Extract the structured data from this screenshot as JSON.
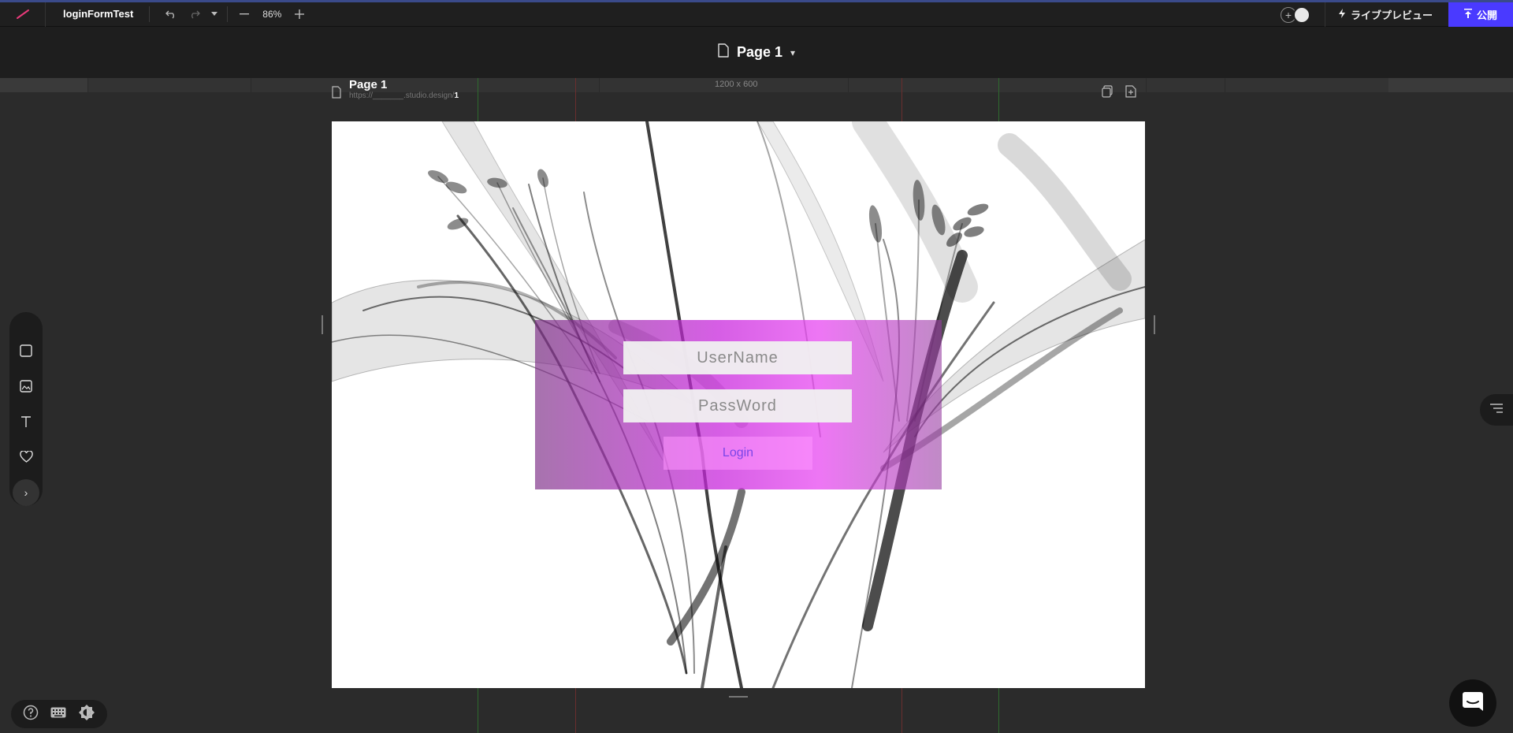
{
  "toolbar": {
    "project_title": "loginFormTest",
    "zoom": "86%",
    "live_preview_label": "ライブプレビュー",
    "publish_label": "公開"
  },
  "pagebar": {
    "page_name": "Page 1"
  },
  "ruler": {
    "size_label": "1200 x 600"
  },
  "frame": {
    "title": "Page 1",
    "url_prefix": "https://_______.studio.design/",
    "url_page": "1"
  },
  "login_form": {
    "username_placeholder": "UserName",
    "password_placeholder": "PassWord",
    "login_label": "Login"
  },
  "colors": {
    "accent": "#4a3aff",
    "panel_magenta": "#c828dc",
    "login_text": "#7a45e8"
  },
  "icons": {
    "left_tools": [
      "box-icon",
      "image-icon",
      "text-icon",
      "heart-icon",
      "chevron-right-icon"
    ],
    "bottom_tools": [
      "help-icon",
      "keyboard-icon",
      "theme-icon"
    ]
  }
}
